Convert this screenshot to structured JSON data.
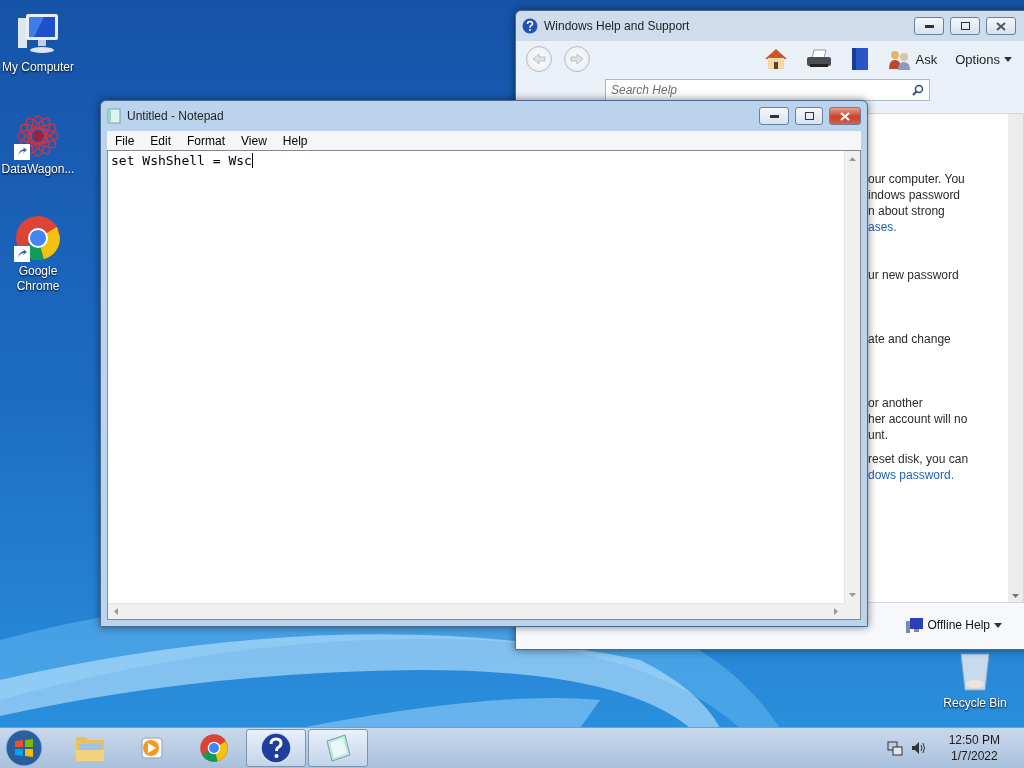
{
  "desktop": {
    "icons": [
      {
        "kind": "computer",
        "label": "My Computer",
        "shortcut": false
      },
      {
        "kind": "datawagon",
        "label": "DataWagon...",
        "shortcut": true
      },
      {
        "kind": "chrome",
        "label": "Google Chrome",
        "shortcut": true
      },
      {
        "kind": "recycle",
        "label": "Recycle Bin",
        "shortcut": false
      }
    ]
  },
  "help_window": {
    "title": "Windows Help and Support",
    "toolbar": {
      "ask": "Ask",
      "options": "Options"
    },
    "search": {
      "placeholder": "Search Help"
    },
    "paragraphs": [
      {
        "lines": [
          {
            "text": "our computer. You",
            "link": false
          },
          {
            "text": "indows password",
            "link": false
          },
          {
            "text": "n about strong",
            "link": false
          },
          {
            "text": "ases.",
            "link": true
          }
        ]
      },
      {
        "lines": [
          {
            "text": "ur new password",
            "link": false
          }
        ]
      },
      {
        "lines": [
          {
            "text": "ate and change",
            "link": false
          }
        ]
      },
      {
        "lines": [
          {
            "text": "or another",
            "link": false
          },
          {
            "text": "her account will no",
            "link": false
          },
          {
            "text": "unt.",
            "link": false
          }
        ]
      },
      {
        "lines": [
          {
            "text": "reset disk, you can",
            "link": false
          },
          {
            "text": "dows password.",
            "link": true
          }
        ]
      }
    ],
    "footer": "Offline Help"
  },
  "notepad": {
    "title": "Untitled - Notepad",
    "menu": [
      "File",
      "Edit",
      "Format",
      "View",
      "Help"
    ],
    "text": "set WshShell = Wsc"
  },
  "taskbar": {
    "items": [
      {
        "kind": "explorer",
        "running": false
      },
      {
        "kind": "media",
        "running": false
      },
      {
        "kind": "chrome",
        "running": false
      },
      {
        "kind": "help",
        "running": true
      },
      {
        "kind": "notepad",
        "running": true
      }
    ],
    "time": "12:50 PM",
    "date": "1/7/2022"
  }
}
